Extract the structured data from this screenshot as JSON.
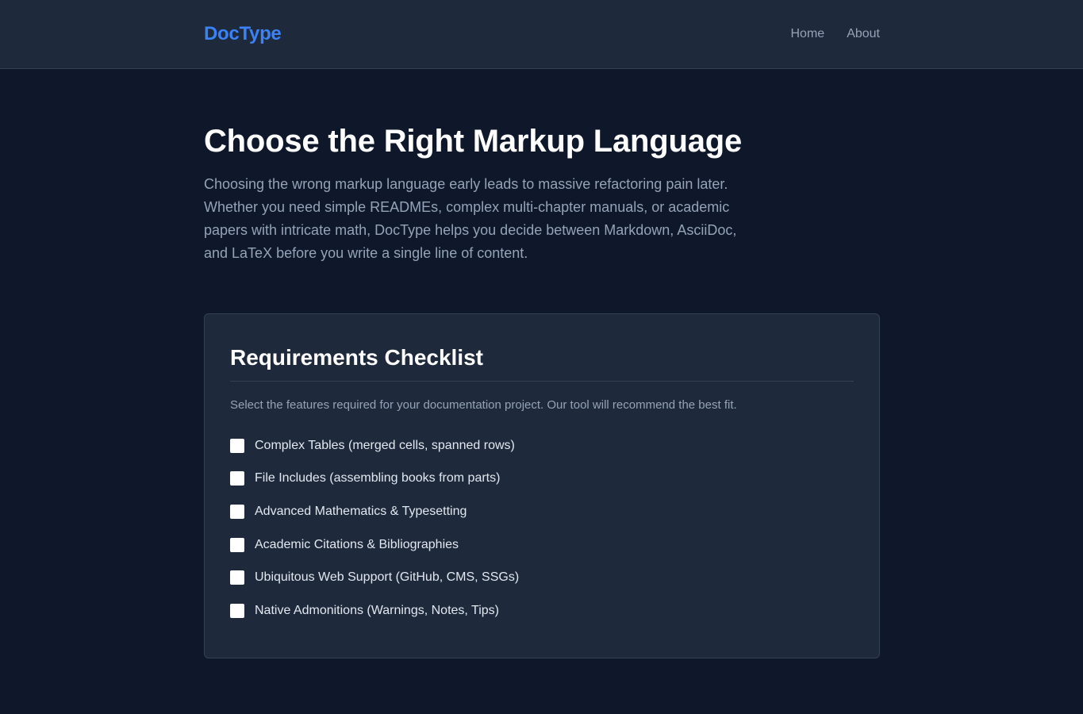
{
  "header": {
    "logo": "DocType",
    "nav": [
      "Home",
      "About"
    ]
  },
  "hero": {
    "title": "Choose the Right Markup Language",
    "description": "Choosing the wrong markup language early leads to massive refactoring pain later. Whether you need simple READMEs, complex multi-chapter manuals, or academic papers with intricate math, DocType helps you decide between Markdown, AsciiDoc, and LaTeX before you write a single line of content."
  },
  "checklist": {
    "title": "Requirements Checklist",
    "description": "Select the features required for your documentation project. Our tool will recommend the best fit.",
    "items": [
      {
        "label": "Complex Tables (merged cells, spanned rows)",
        "checked": false
      },
      {
        "label": "File Includes (assembling books from parts)",
        "checked": false
      },
      {
        "label": "Advanced Mathematics & Typesetting",
        "checked": false
      },
      {
        "label": "Academic Citations & Bibliographies",
        "checked": false
      },
      {
        "label": "Ubiquitous Web Support (GitHub, CMS, SSGs)",
        "checked": false
      },
      {
        "label": "Native Admonitions (Warnings, Notes, Tips)",
        "checked": false
      }
    ]
  },
  "colors": {
    "background": "#0f172a",
    "surface": "#1e293b",
    "accent": "#3b82f6",
    "text_muted": "#94a3b8"
  }
}
